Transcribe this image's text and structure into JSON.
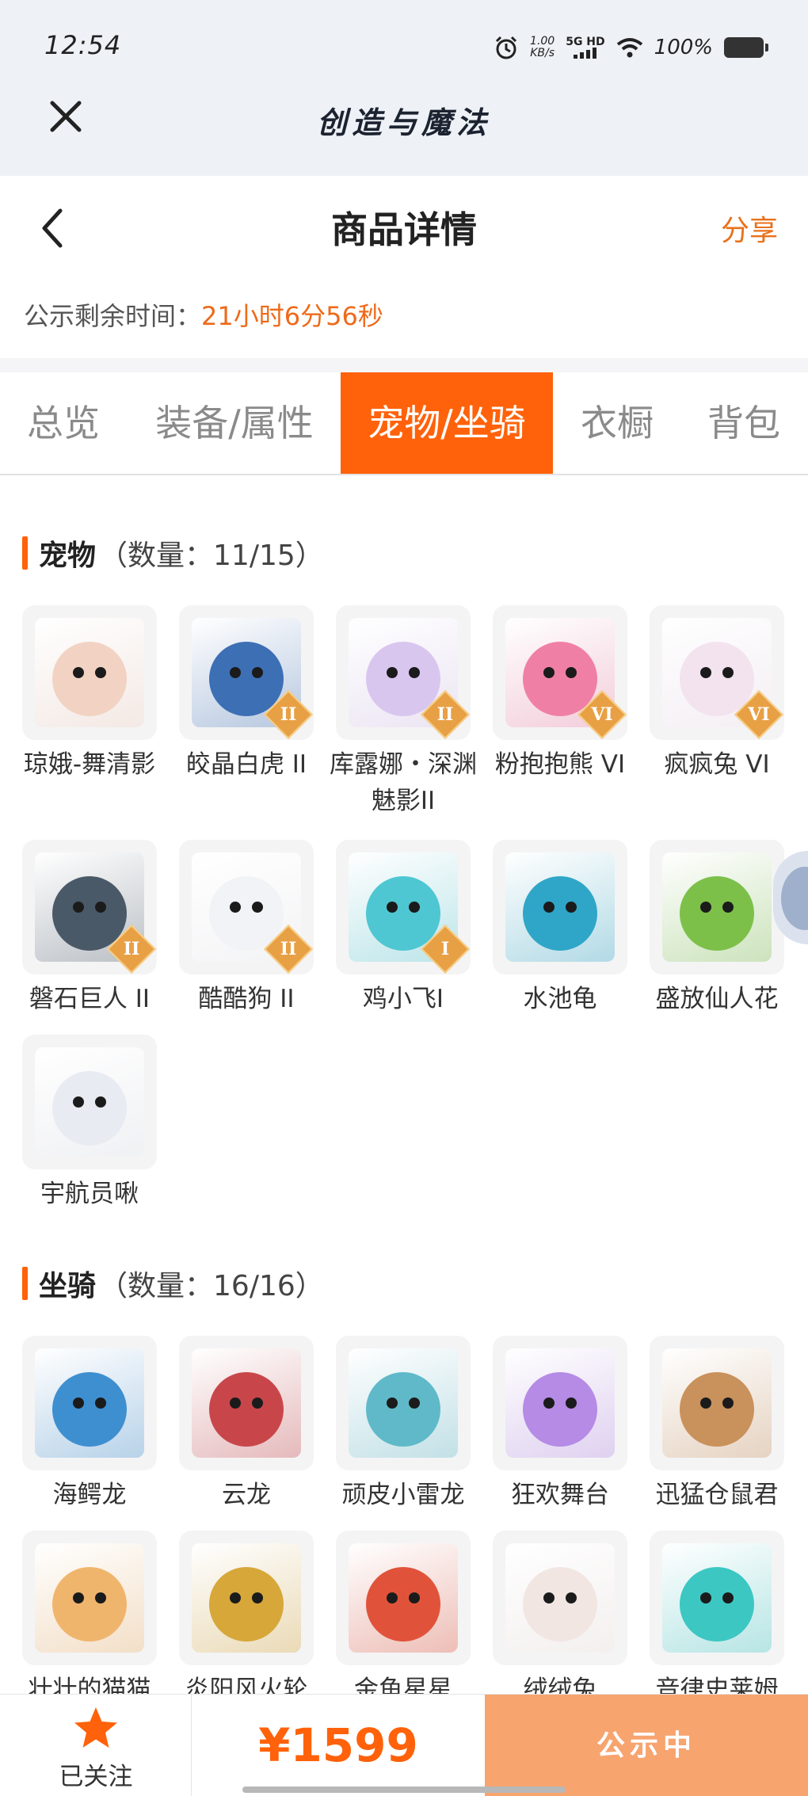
{
  "status_bar": {
    "time": "12:54",
    "net_speed_value": "1.00",
    "net_speed_unit": "KB/s",
    "network": "5G HD",
    "battery": "100%"
  },
  "app": {
    "title": "创造与魔法"
  },
  "page": {
    "title": "商品详情",
    "share_label": "分享",
    "countdown_label": "公示剩余时间：",
    "countdown_value": "21小时6分56秒"
  },
  "tabs": [
    {
      "label": "总览"
    },
    {
      "label": "装备/属性"
    },
    {
      "label": "宠物/坐骑",
      "active": true
    },
    {
      "label": "衣橱"
    },
    {
      "label": "背包"
    }
  ],
  "pets": {
    "title": "宠物",
    "count": "（数量：11/15）",
    "items": [
      {
        "name": "琼娥-舞清影",
        "badge": "",
        "color": "#f2d3c3"
      },
      {
        "name": "皎晶白虎 II",
        "badge": "II",
        "color": "#3d6fb5"
      },
      {
        "name": "库露娜・深渊魅影II",
        "badge": "II",
        "color": "#d9c6ef"
      },
      {
        "name": "粉抱抱熊 VI",
        "badge": "VI",
        "color": "#f07fa6"
      },
      {
        "name": "疯疯兔 VI",
        "badge": "VI",
        "color": "#f3e3ef"
      },
      {
        "name": "磐石巨人 II",
        "badge": "II",
        "color": "#4a5968"
      },
      {
        "name": "酷酷狗 II",
        "badge": "II",
        "color": "#f2f3f6"
      },
      {
        "name": "鸡小飞I",
        "badge": "I",
        "color": "#4ec7d2"
      },
      {
        "name": "水池龟",
        "badge": "",
        "color": "#2fa6c8"
      },
      {
        "name": "盛放仙人花",
        "badge": "",
        "color": "#7cc04a"
      },
      {
        "name": "宇航员啾",
        "badge": "",
        "color": "#e8ebf1"
      }
    ]
  },
  "mounts": {
    "title": "坐骑",
    "count": "（数量：16/16）",
    "items": [
      {
        "name": "海鳄龙",
        "color": "#3e8fd0"
      },
      {
        "name": "云龙",
        "color": "#c8464a"
      },
      {
        "name": "顽皮小雷龙",
        "color": "#5fb9c9"
      },
      {
        "name": "狂欢舞台",
        "color": "#b58be6"
      },
      {
        "name": "迅猛仓鼠君",
        "color": "#c9915b"
      },
      {
        "name": "壮壮的猫猫",
        "color": "#f0b56d"
      },
      {
        "name": "炎阳风火轮",
        "color": "#d7a73a"
      },
      {
        "name": "金鱼星星",
        "color": "#e0533a"
      },
      {
        "name": "绒绒兔",
        "color": "#f1e6e2"
      },
      {
        "name": "音律史莱姆",
        "color": "#3cc7c3"
      }
    ]
  },
  "bottom": {
    "follow_label": "已关注",
    "price": "¥1599",
    "status_label": "公示中"
  },
  "colors": {
    "accent": "#ff620a",
    "status_button": "#f7a46f"
  }
}
